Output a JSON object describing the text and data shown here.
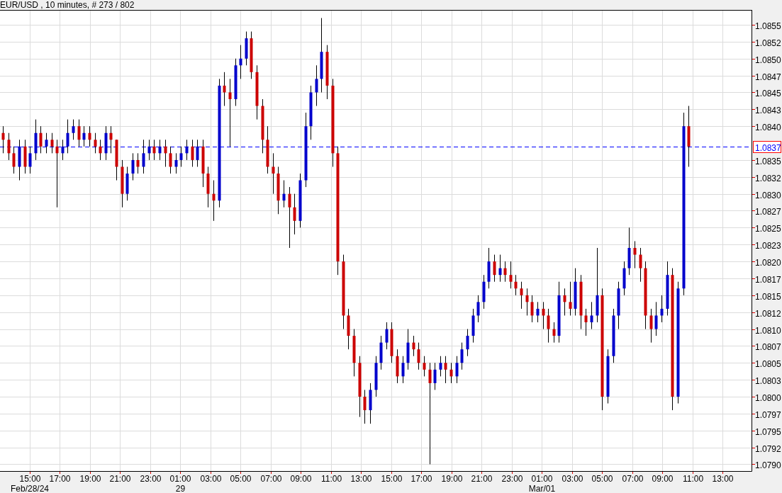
{
  "title": "EUR/USD , 10 minutes, # 273 / 802",
  "chart": {
    "chart_data": {
      "type": "candlestick",
      "xlim": [
        "--02-28 13:01:26",
        "--03-01 14:54:22"
      ],
      "ylim": [
        1.0789,
        1.08572
      ],
      "grid": true,
      "x": [
        "--02-28 13:13:00",
        "--02-28 13:34:30",
        "--02-28 13:56:00",
        "--02-28 14:17:30",
        "--02-28 14:39:00",
        "--02-28 15:00:30",
        "--02-28 15:22:00",
        "--02-28 15:43:30",
        "--02-28 16:05:00",
        "--02-28 16:26:30",
        "--02-28 16:48:00",
        "--02-28 17:09:30",
        "--02-28 17:31:00",
        "--02-28 17:52:30",
        "--02-28 18:14:00",
        "--02-28 18:35:30",
        "--02-28 18:57:00",
        "--02-28 19:18:30",
        "--02-28 19:40:00",
        "--02-28 20:01:30",
        "--02-28 20:23:00",
        "--02-28 20:44:30",
        "--02-28 21:06:00",
        "--02-28 21:27:30",
        "--02-28 21:49:00",
        "--02-28 22:10:30",
        "--02-28 22:32:00",
        "--02-28 22:53:30",
        "--02-28 23:15:00",
        "--02-28 23:36:30",
        "--02-28 23:58:00",
        "--02-29 00:19:30",
        "--02-29 00:41:00",
        "--02-29 01:02:30",
        "--02-29 01:24:00",
        "--02-29 01:45:30",
        "--02-29 02:07:00",
        "--02-29 02:28:30",
        "--02-29 02:50:00",
        "--02-29 03:11:30",
        "--02-29 03:33:00",
        "--02-29 03:54:30",
        "--02-29 04:16:00",
        "--02-29 04:37:30",
        "--02-29 04:59:00",
        "--02-29 05:20:30",
        "--02-29 05:42:00",
        "--02-29 06:03:30",
        "--02-29 06:25:00",
        "--02-29 06:46:30",
        "--02-29 07:08:00",
        "--02-29 07:29:30",
        "--02-29 07:51:00",
        "--02-29 08:12:30",
        "--02-29 08:34:00",
        "--02-29 08:55:30",
        "--02-29 09:17:00",
        "--02-29 09:38:30",
        "--02-29 10:00:00",
        "--02-29 10:21:30",
        "--02-29 10:43:00",
        "--02-29 11:04:30",
        "--02-29 11:26:00",
        "--02-29 11:47:30",
        "--02-29 12:09:00",
        "--02-29 12:30:30",
        "--02-29 12:52:00",
        "--02-29 13:13:30",
        "--02-29 13:35:00",
        "--02-29 13:56:30",
        "--02-29 14:18:00",
        "--02-29 14:39:30",
        "--02-29 15:01:00",
        "--02-29 15:22:30",
        "--02-29 15:44:00",
        "--02-29 16:05:30",
        "--02-29 16:27:00",
        "--02-29 16:48:30",
        "--02-29 17:10:00",
        "--02-29 17:31:30",
        "--02-29 17:53:00",
        "--02-29 18:14:30",
        "--02-29 18:36:00",
        "--02-29 18:57:30",
        "--02-29 19:19:00",
        "--02-29 19:40:30",
        "--02-29 20:02:00",
        "--02-29 20:23:30",
        "--02-29 20:45:00",
        "--02-29 21:06:30",
        "--02-29 21:28:00",
        "--02-29 21:49:30",
        "--02-29 22:11:00",
        "--02-29 22:32:30",
        "--02-29 22:54:00",
        "--02-29 23:15:30",
        "--02-29 23:37:00",
        "--02-29 23:58:30",
        "--03-01 00:20:00",
        "--03-01 00:41:30",
        "--03-01 01:03:00",
        "--03-01 01:24:30",
        "--03-01 01:46:00",
        "--03-01 02:07:30",
        "--03-01 02:29:00",
        "--03-01 02:50:30",
        "--03-01 03:12:00",
        "--03-01 03:33:30",
        "--03-01 03:55:00",
        "--03-01 04:16:30",
        "--03-01 04:38:00",
        "--03-01 04:59:30",
        "--03-01 05:21:00",
        "--03-01 05:42:30",
        "--03-01 06:04:00",
        "--03-01 06:25:30",
        "--03-01 06:47:00",
        "--03-01 07:08:30",
        "--03-01 07:30:00",
        "--03-01 07:51:30",
        "--03-01 08:13:00",
        "--03-01 08:34:30",
        "--03-01 08:56:00",
        "--03-01 09:17:30",
        "--03-01 09:39:00",
        "--03-01 10:00:30",
        "--03-01 10:22:00",
        "--03-01 10:43:30"
      ],
      "xticks": [
        {
          "value": "--02-28 15:00:00",
          "label": "15:00"
        },
        {
          "value": "--02-28 17:00:00",
          "label": "17:00"
        },
        {
          "value": "--02-28 19:00:00",
          "label": "19:00"
        },
        {
          "value": "--02-28 21:00:00",
          "label": "21:00"
        },
        {
          "value": "--02-28 23:00:00",
          "label": "23:00"
        },
        {
          "value": "--02-29 01:00:00",
          "label": "01:00"
        },
        {
          "value": "--02-29 03:00:00",
          "label": "03:00"
        },
        {
          "value": "--02-29 05:00:00",
          "label": "05:00"
        },
        {
          "value": "--02-29 07:00:00",
          "label": "07:00"
        },
        {
          "value": "--02-29 09:00:00",
          "label": "09:00"
        },
        {
          "value": "--02-29 11:00:00",
          "label": "11:00"
        },
        {
          "value": "--02-29 13:00:00",
          "label": "13:00"
        },
        {
          "value": "--02-29 15:00:00",
          "label": "15:00"
        },
        {
          "value": "--02-29 17:00:00",
          "label": "17:00"
        },
        {
          "value": "--02-29 19:00:00",
          "label": "19:00"
        },
        {
          "value": "--02-29 21:00:00",
          "label": "21:00"
        },
        {
          "value": "--02-29 23:00:00",
          "label": "23:00"
        },
        {
          "value": "--03-01 01:00:00",
          "label": "01:00"
        },
        {
          "value": "--03-01 03:00:00",
          "label": "03:00"
        },
        {
          "value": "--03-01 05:00:00",
          "label": "05:00"
        },
        {
          "value": "--03-01 07:00:00",
          "label": "07:00"
        },
        {
          "value": "--03-01 09:00:00",
          "label": "09:00"
        },
        {
          "value": "--03-01 11:00:00",
          "label": "11:00"
        },
        {
          "value": "--03-01 13:00:00",
          "label": "13:00"
        }
      ],
      "annotations": [
        "Feb/28/24",
        "29",
        "Mar/01"
      ],
      "yticks": [
        {
          "value": 1.0855,
          "label": "1.0855"
        },
        {
          "value": 1.08525,
          "label": "1.0852"
        },
        {
          "value": 1.085,
          "label": "1.0850"
        },
        {
          "value": 1.08475,
          "label": "1.0847"
        },
        {
          "value": 1.0845,
          "label": "1.0845"
        },
        {
          "value": 1.08425,
          "label": "1.0843"
        },
        {
          "value": 1.084,
          "label": "1.0840"
        },
        {
          "value": 1.0835,
          "label": "1.0835"
        },
        {
          "value": 1.08325,
          "label": "1.0832"
        },
        {
          "value": 1.083,
          "label": "1.0830"
        },
        {
          "value": 1.08275,
          "label": "1.0827"
        },
        {
          "value": 1.0825,
          "label": "1.0825"
        },
        {
          "value": 1.08225,
          "label": "1.0823"
        },
        {
          "value": 1.082,
          "label": "1.0820"
        },
        {
          "value": 1.08175,
          "label": "1.0817"
        },
        {
          "value": 1.0815,
          "label": "1.0815"
        },
        {
          "value": 1.08125,
          "label": "1.0812"
        },
        {
          "value": 1.081,
          "label": "1.0810"
        },
        {
          "value": 1.08075,
          "label": "1.0807"
        },
        {
          "value": 1.0805,
          "label": "1.0805"
        },
        {
          "value": 1.08025,
          "label": "1.0803"
        },
        {
          "value": 1.08,
          "label": "1.0800"
        },
        {
          "value": 1.07975,
          "label": "1.0797"
        },
        {
          "value": 1.0795,
          "label": "1.0795"
        },
        {
          "value": 1.07925,
          "label": "1.0792"
        },
        {
          "value": 1.079,
          "label": "1.0790"
        }
      ],
      "ref_lines": [
        {
          "axis": "y",
          "value": 1.0837,
          "label": "1.0837"
        }
      ],
      "ohlc": [
        [
          1.0839,
          1.084,
          1.0836,
          1.0838
        ],
        [
          1.0838,
          1.0839,
          1.0835,
          1.0836
        ],
        [
          1.0836,
          1.0837,
          1.0833,
          1.0834
        ],
        [
          1.0834,
          1.0838,
          1.0832,
          1.0837
        ],
        [
          1.0837,
          1.0838,
          1.0833,
          1.0834
        ],
        [
          1.0834,
          1.0837,
          1.0833,
          1.0836
        ],
        [
          1.0836,
          1.0841,
          1.0835,
          1.0839
        ],
        [
          1.0839,
          1.084,
          1.0836,
          1.0837
        ],
        [
          1.0837,
          1.0839,
          1.0836,
          1.0838
        ],
        [
          1.0838,
          1.0839,
          1.0836,
          1.0837
        ],
        [
          1.0837,
          1.0838,
          1.0828,
          1.0836
        ],
        [
          1.0836,
          1.0838,
          1.0835,
          1.0837
        ],
        [
          1.0837,
          1.0841,
          1.0836,
          1.0839
        ],
        [
          1.0839,
          1.0841,
          1.0838,
          1.084
        ],
        [
          1.084,
          1.0841,
          1.0837,
          1.0838
        ],
        [
          1.0838,
          1.084,
          1.0837,
          1.0839
        ],
        [
          1.0839,
          1.084,
          1.0837,
          1.0838
        ],
        [
          1.0838,
          1.0839,
          1.0836,
          1.0837
        ],
        [
          1.0837,
          1.0838,
          1.0835,
          1.0836
        ],
        [
          1.0836,
          1.084,
          1.0835,
          1.0839
        ],
        [
          1.0839,
          1.084,
          1.0836,
          1.0838
        ],
        [
          1.0838,
          1.0838,
          1.0832,
          1.0834
        ],
        [
          1.0834,
          1.0835,
          1.0828,
          1.083
        ],
        [
          1.083,
          1.0834,
          1.0829,
          1.0833
        ],
        [
          1.0833,
          1.0836,
          1.0832,
          1.0835
        ],
        [
          1.0835,
          1.0836,
          1.0833,
          1.0834
        ],
        [
          1.0834,
          1.0838,
          1.0833,
          1.0836
        ],
        [
          1.0836,
          1.0838,
          1.0835,
          1.0837
        ],
        [
          1.0837,
          1.0838,
          1.0835,
          1.0836
        ],
        [
          1.0836,
          1.0838,
          1.0835,
          1.0837
        ],
        [
          1.0837,
          1.0838,
          1.0834,
          1.0836
        ],
        [
          1.0836,
          1.0837,
          1.0833,
          1.0834
        ],
        [
          1.0834,
          1.0836,
          1.0833,
          1.0835
        ],
        [
          1.0835,
          1.0837,
          1.0834,
          1.0836
        ],
        [
          1.0836,
          1.0838,
          1.0835,
          1.0837
        ],
        [
          1.0837,
          1.0838,
          1.0834,
          1.0835
        ],
        [
          1.0835,
          1.0838,
          1.0834,
          1.0837
        ],
        [
          1.0837,
          1.0838,
          1.0831,
          1.0833
        ],
        [
          1.0833,
          1.0834,
          1.0828,
          1.083
        ],
        [
          1.083,
          1.0832,
          1.0826,
          1.0829
        ],
        [
          1.0829,
          1.0847,
          1.0828,
          1.0846
        ],
        [
          1.0846,
          1.0848,
          1.0843,
          1.0845
        ],
        [
          1.0845,
          1.0847,
          1.0837,
          1.0844
        ],
        [
          1.0844,
          1.085,
          1.0843,
          1.0849
        ],
        [
          1.0849,
          1.0852,
          1.0847,
          1.085
        ],
        [
          1.085,
          1.0854,
          1.0849,
          1.0853
        ],
        [
          1.0853,
          1.0854,
          1.0847,
          1.0848
        ],
        [
          1.0848,
          1.0849,
          1.0841,
          1.0843
        ],
        [
          1.0843,
          1.0844,
          1.0836,
          1.0838
        ],
        [
          1.0838,
          1.084,
          1.0833,
          1.0834
        ],
        [
          1.0834,
          1.0836,
          1.083,
          1.0833
        ],
        [
          1.0833,
          1.0834,
          1.0827,
          1.0829
        ],
        [
          1.0829,
          1.0832,
          1.0828,
          1.083
        ],
        [
          1.083,
          1.0831,
          1.0822,
          1.0828
        ],
        [
          1.0828,
          1.083,
          1.0824,
          1.0826
        ],
        [
          1.0826,
          1.0833,
          1.0825,
          1.0832
        ],
        [
          1.0832,
          1.0842,
          1.0831,
          1.084
        ],
        [
          1.084,
          1.0846,
          1.0838,
          1.0845
        ],
        [
          1.0845,
          1.0849,
          1.0843,
          1.0847
        ],
        [
          1.0847,
          1.0856,
          1.0845,
          1.0851
        ],
        [
          1.0851,
          1.0852,
          1.0844,
          1.0846
        ],
        [
          1.0846,
          1.0847,
          1.0834,
          1.0836
        ],
        [
          1.0836,
          1.0837,
          1.0818,
          1.082
        ],
        [
          1.082,
          1.0821,
          1.081,
          1.0812
        ],
        [
          1.0812,
          1.0813,
          1.0807,
          1.0809
        ],
        [
          1.0809,
          1.081,
          1.0803,
          1.0805
        ],
        [
          1.0805,
          1.0806,
          1.0797,
          1.08
        ],
        [
          1.08,
          1.0801,
          1.0796,
          1.0798
        ],
        [
          1.0798,
          1.0802,
          1.0796,
          1.0801
        ],
        [
          1.0801,
          1.0806,
          1.08,
          1.0805
        ],
        [
          1.0805,
          1.0809,
          1.0804,
          1.0808
        ],
        [
          1.0808,
          1.0811,
          1.0807,
          1.081
        ],
        [
          1.081,
          1.0811,
          1.0805,
          1.0806
        ],
        [
          1.0806,
          1.0807,
          1.0802,
          1.0803
        ],
        [
          1.0803,
          1.0806,
          1.0802,
          1.0805
        ],
        [
          1.0805,
          1.081,
          1.0804,
          1.0808
        ],
        [
          1.0808,
          1.0809,
          1.0806,
          1.0807
        ],
        [
          1.0807,
          1.0808,
          1.0804,
          1.0805
        ],
        [
          1.0805,
          1.0806,
          1.0803,
          1.0804
        ],
        [
          1.0804,
          1.0805,
          1.079,
          1.0802
        ],
        [
          1.0802,
          1.0805,
          1.0801,
          1.0804
        ],
        [
          1.0804,
          1.0806,
          1.0803,
          1.0805
        ],
        [
          1.0805,
          1.0806,
          1.0802,
          1.0804
        ],
        [
          1.0804,
          1.0805,
          1.0802,
          1.0803
        ],
        [
          1.0803,
          1.0806,
          1.0802,
          1.0805
        ],
        [
          1.0805,
          1.0808,
          1.0804,
          1.0807
        ],
        [
          1.0807,
          1.081,
          1.0806,
          1.0809
        ],
        [
          1.0809,
          1.0813,
          1.0808,
          1.0812
        ],
        [
          1.0812,
          1.0815,
          1.0811,
          1.0814
        ],
        [
          1.0814,
          1.0818,
          1.0813,
          1.0817
        ],
        [
          1.0817,
          1.0822,
          1.0816,
          1.082
        ],
        [
          1.082,
          1.0821,
          1.0817,
          1.0818
        ],
        [
          1.0818,
          1.0821,
          1.0817,
          1.0819
        ],
        [
          1.0819,
          1.082,
          1.0817,
          1.0818
        ],
        [
          1.0818,
          1.082,
          1.0816,
          1.0817
        ],
        [
          1.0817,
          1.0818,
          1.0815,
          1.0816
        ],
        [
          1.0816,
          1.0817,
          1.0813,
          1.0815
        ],
        [
          1.0815,
          1.0816,
          1.0812,
          1.0814
        ],
        [
          1.0814,
          1.0815,
          1.0811,
          1.0812
        ],
        [
          1.0812,
          1.0814,
          1.0811,
          1.0813
        ],
        [
          1.0813,
          1.0814,
          1.081,
          1.0812
        ],
        [
          1.0812,
          1.0813,
          1.0808,
          1.081
        ],
        [
          1.081,
          1.0811,
          1.0808,
          1.0809
        ],
        [
          1.0809,
          1.0817,
          1.0808,
          1.0815
        ],
        [
          1.0815,
          1.0816,
          1.0812,
          1.0814
        ],
        [
          1.0814,
          1.0817,
          1.0812,
          1.0813
        ],
        [
          1.0813,
          1.0819,
          1.0812,
          1.0817
        ],
        [
          1.0817,
          1.0818,
          1.081,
          1.0812
        ],
        [
          1.0812,
          1.0813,
          1.0809,
          1.0811
        ],
        [
          1.0811,
          1.0814,
          1.081,
          1.0812
        ],
        [
          1.0812,
          1.0822,
          1.0811,
          1.0815
        ],
        [
          1.0815,
          1.0816,
          1.0798,
          1.08
        ],
        [
          1.08,
          1.0807,
          1.0799,
          1.0806
        ],
        [
          1.0806,
          1.0813,
          1.0805,
          1.0812
        ],
        [
          1.0812,
          1.0817,
          1.081,
          1.0816
        ],
        [
          1.0816,
          1.082,
          1.0815,
          1.0819
        ],
        [
          1.0819,
          1.0825,
          1.0818,
          1.0822
        ],
        [
          1.0822,
          1.0823,
          1.0819,
          1.0821
        ],
        [
          1.0821,
          1.0822,
          1.0817,
          1.0819
        ],
        [
          1.0819,
          1.082,
          1.081,
          1.0812
        ],
        [
          1.0812,
          1.0813,
          1.0808,
          1.081
        ],
        [
          1.081,
          1.0814,
          1.0809,
          1.0812
        ],
        [
          1.0812,
          1.0815,
          1.0811,
          1.0813
        ],
        [
          1.0813,
          1.082,
          1.0812,
          1.0818
        ],
        [
          1.0818,
          1.0819,
          1.0798,
          1.08
        ],
        [
          1.08,
          1.0817,
          1.0799,
          1.0816
        ],
        [
          1.0816,
          1.0842,
          1.0815,
          1.084
        ],
        [
          1.084,
          1.0843,
          1.0834,
          1.0837
        ]
      ]
    }
  }
}
